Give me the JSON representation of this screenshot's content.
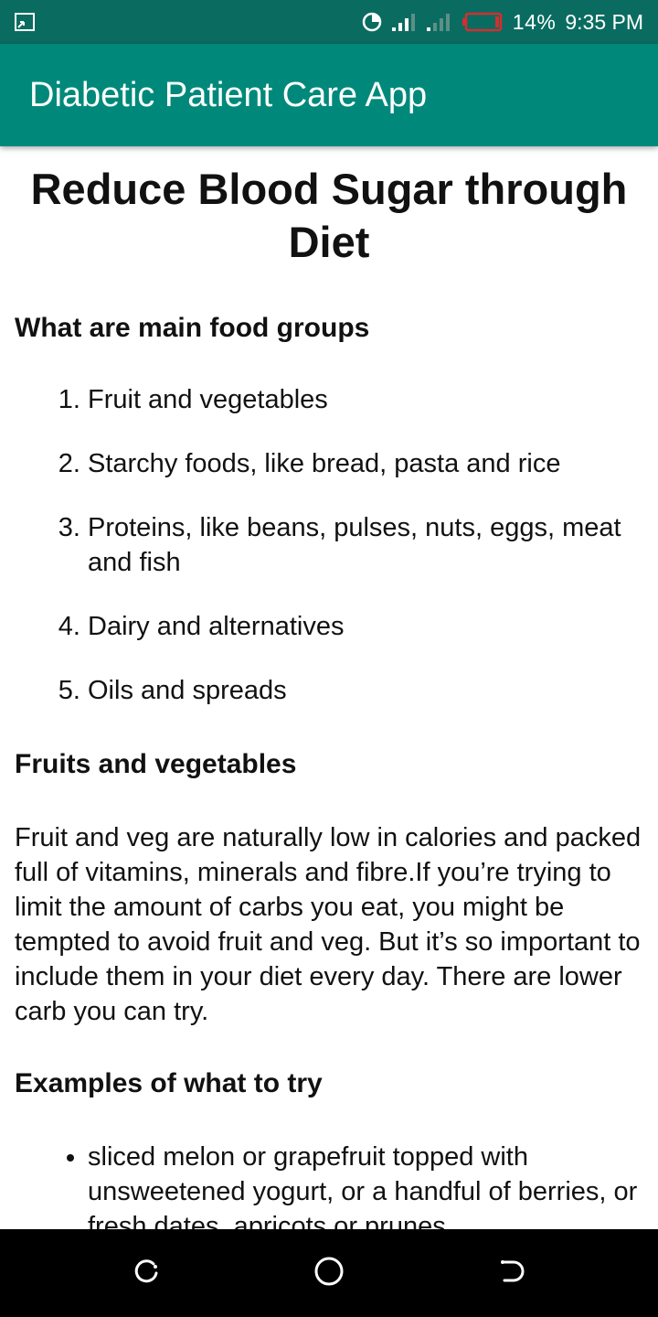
{
  "status_bar": {
    "battery_percent": "14%",
    "time": "9:35 PM",
    "left_icon": "screen-cast-icon",
    "icons": [
      "data-saver-icon",
      "signal-sim1-icon",
      "signal-sim2-icon",
      "battery-low-icon"
    ],
    "battery_color": "#d32f2f"
  },
  "app_bar": {
    "title": "Diabetic Patient Care App",
    "color": "#00897b"
  },
  "content": {
    "page_title": "Reduce Blood Sugar through Diet",
    "food_groups_heading": "What are main food groups",
    "food_groups": [
      "Fruit and vegetables",
      "Starchy foods, like bread, pasta and rice",
      "Proteins, like beans, pulses, nuts, eggs, meat and fish",
      "Dairy and alternatives",
      "Oils and spreads"
    ],
    "fruits_heading": "Fruits and vegetables",
    "fruits_paragraph": "Fruit and veg are naturally low in calories and packed full of vitamins, minerals and fibre.If you’re trying to limit the amount of carbs you eat, you might be tempted to avoid fruit and veg. But it’s so important to include them in your diet every day. There are lower carb you can try.",
    "examples_heading": "Examples of what to try",
    "examples": [
      "sliced melon or grapefruit topped with unsweetened yogurt, or a handful of berries, or fresh dates, apricots or prunes"
    ]
  },
  "nav_bar": {
    "buttons": [
      "recent-apps-icon",
      "home-icon",
      "back-icon"
    ]
  }
}
